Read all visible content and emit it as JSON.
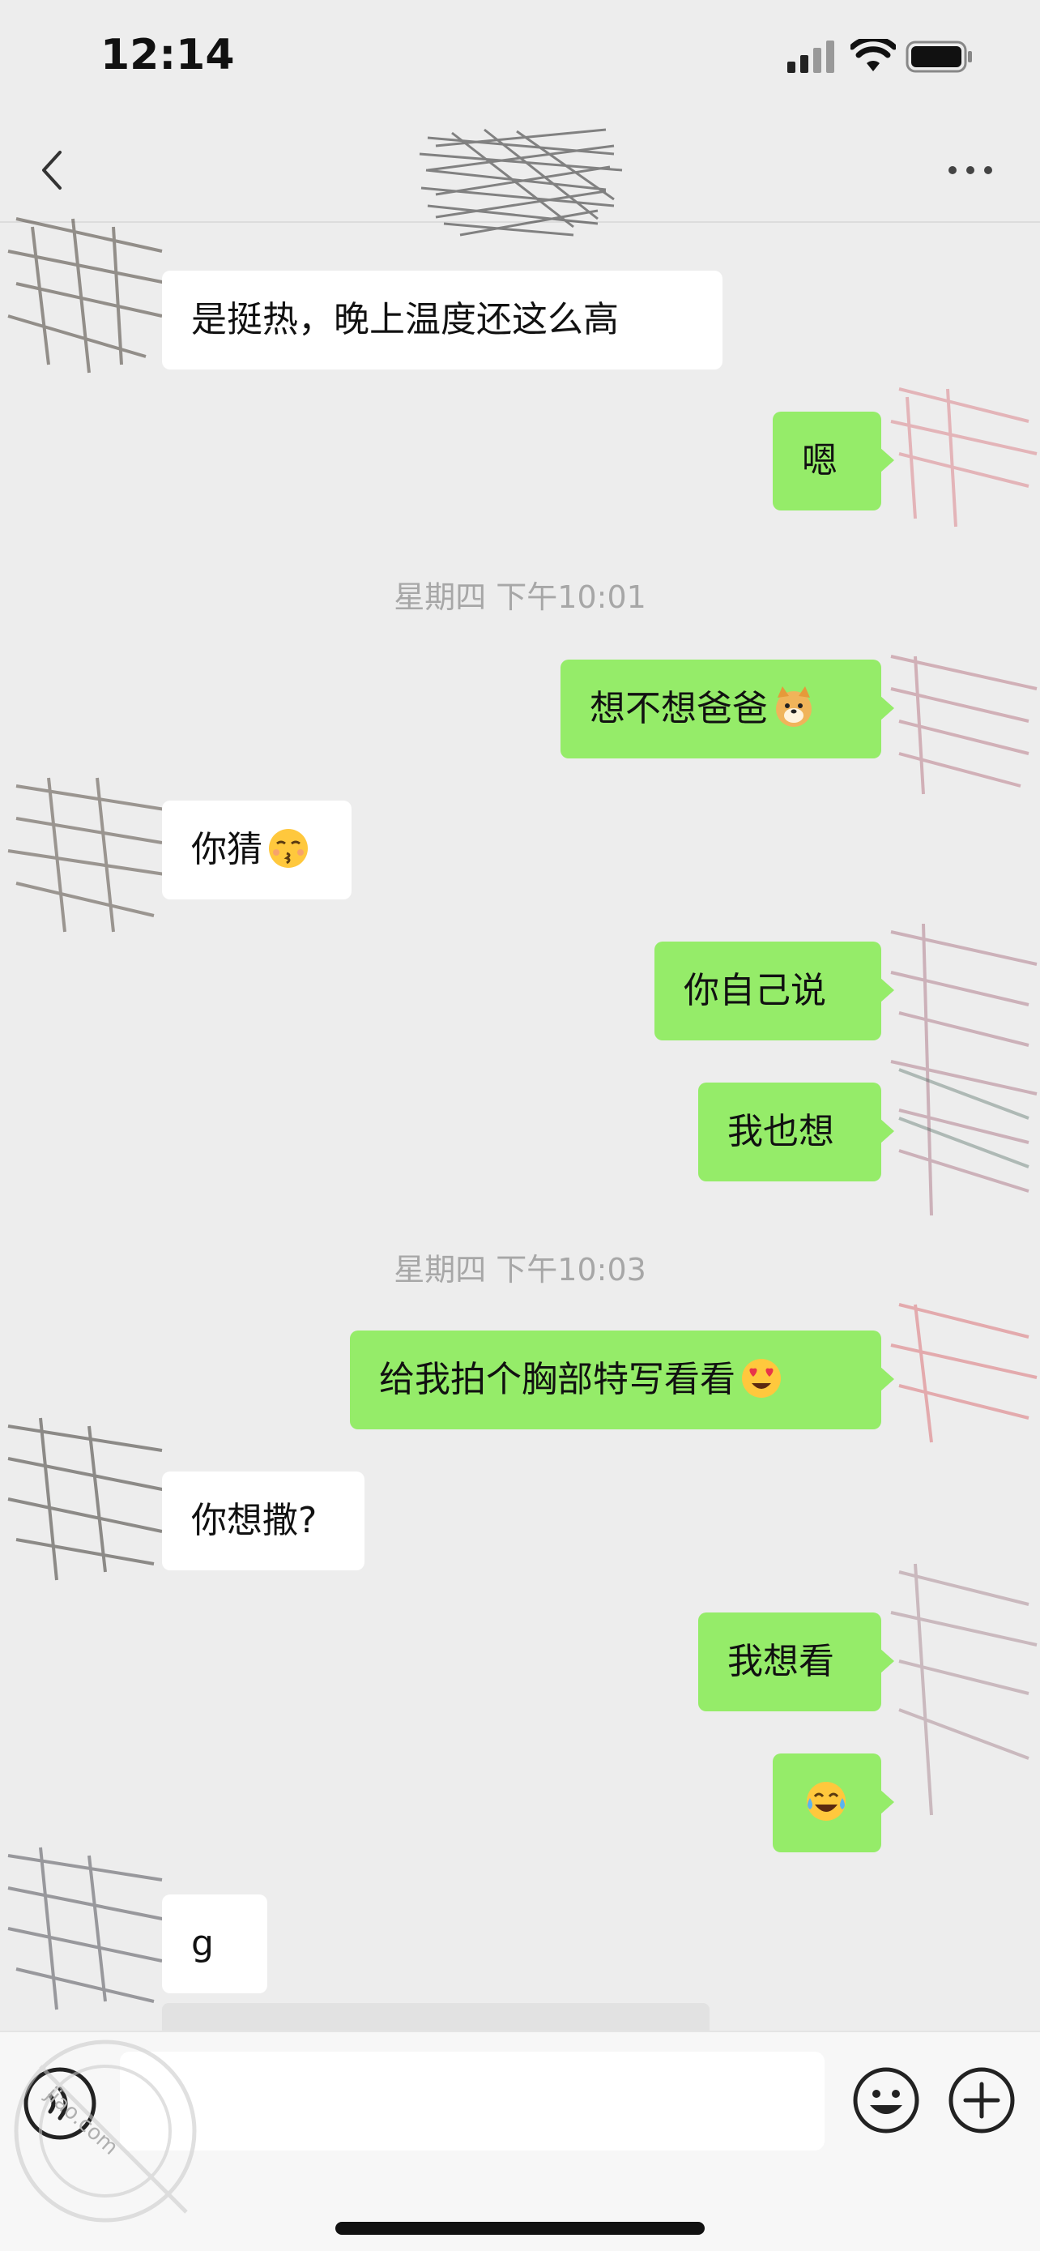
{
  "status_bar": {
    "time": "12:14"
  },
  "nav": {
    "back_icon": "chevron-left-icon",
    "more_icon": "ellipsis-icon"
  },
  "messages": [
    {
      "side": "received",
      "text": "是挺热，晚上温度还这么高"
    },
    {
      "side": "sent",
      "text": "嗯"
    },
    {
      "type": "timestamp",
      "text": "星期四 下午10:01"
    },
    {
      "side": "sent",
      "text": "想不想爸爸",
      "emoji": "dog-face-emoji"
    },
    {
      "side": "received",
      "text": "你猜",
      "emoji": "kissing-face-emoji"
    },
    {
      "side": "sent",
      "text": "你自己说"
    },
    {
      "side": "sent",
      "text": "我也想"
    },
    {
      "type": "timestamp",
      "text": "星期四 下午10:03"
    },
    {
      "side": "sent",
      "text": "给我拍个胸部特写看看",
      "emoji": "heart-eyes-emoji"
    },
    {
      "side": "received",
      "text": "你想撒?"
    },
    {
      "side": "sent",
      "text": "我想看"
    },
    {
      "side": "sent",
      "text": "",
      "emoji": "tears-of-joy-emoji"
    },
    {
      "side": "received",
      "text": "g"
    }
  ],
  "input_bar": {
    "text_value": "",
    "voice_icon": "voice-icon",
    "emoji_icon": "smiley-icon",
    "plus_icon": "plus-icon"
  },
  "watermark": {
    "text": "jiao.com"
  },
  "colors": {
    "sent_bubble": "#95ec69",
    "received_bubble": "#ffffff",
    "background": "#ededed"
  }
}
